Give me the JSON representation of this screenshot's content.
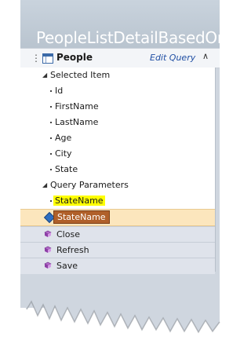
{
  "window": {
    "title": "PeopleListDetailBasedOnSt"
  },
  "header": {
    "title": "People",
    "edit_query": "Edit Query"
  },
  "tree": {
    "selected_item": {
      "label": "Selected Item",
      "fields": [
        "Id",
        "FirstName",
        "LastName",
        "Age",
        "City",
        "State"
      ]
    },
    "query_parameters": {
      "label": "Query Parameters",
      "param": "StateName",
      "selected_param": "StateName"
    }
  },
  "commands": [
    "Close",
    "Refresh",
    "Save"
  ],
  "colors": {
    "highlight": "#ffff00",
    "selection_bg": "#fce6bd",
    "selection_tag": "#b0602a",
    "link": "#1f4ea3"
  }
}
